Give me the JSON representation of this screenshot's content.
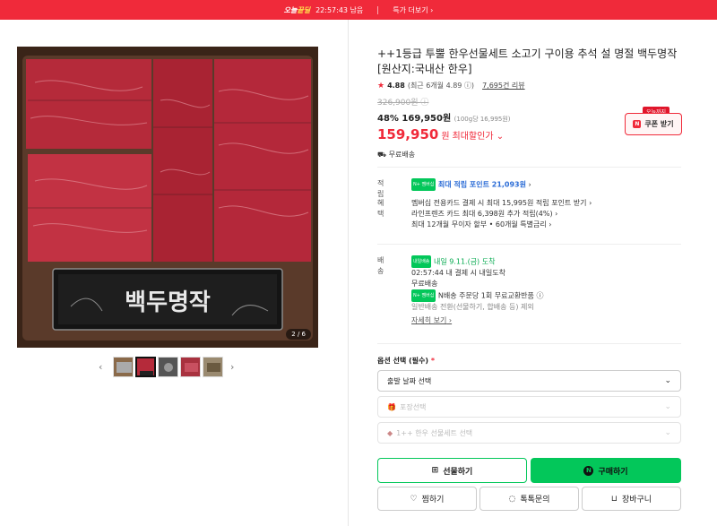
{
  "topbar": {
    "brand_a": "오늘",
    "brand_b": "끝딜",
    "timer": "22:57:43 남음",
    "more": "특가 더보기"
  },
  "gallery": {
    "counter": "2 / 6"
  },
  "product": {
    "title": "++1등급 투뿔 한우선물세트 소고기 구이용 추석 설 명절 백두명작 [원산지:국내산 한우]",
    "rating": "4.88",
    "rating_detail": "(최근 6개월 4.89",
    "reviews": "7,695건 리뷰",
    "original_price": "326,900원",
    "discount": "48%",
    "sale_price": "169,950원",
    "unit_price": "(100g당 16,995원)",
    "final_price": "159,950",
    "final_won": "원",
    "max_discount": "최대할인가",
    "shipping": "무료배송"
  },
  "coupon": {
    "tag": "오늘까지",
    "label": "쿠폰 받기",
    "nbadge": "N"
  },
  "benefit": {
    "point_label": "적립",
    "point_text": "최대 적립 포인트 21,093원",
    "benefit_label": "혜택",
    "line1": "멤버십 전용카드 결제 시 최대 15,995원 적립 포인트 받기",
    "line2": "라인프렌즈 카드 최대 6,398원 추가 적립(4%)",
    "line3": "최대 12개월 무이자 할부 • 60개월 특별금리"
  },
  "delivery": {
    "label": "배송",
    "badge": "내일배송",
    "arrive": "내일 9.11.(금) 도착",
    "cutoff": "02:57:44  내 결제 시 내일도착",
    "free": "무료배송",
    "return": "N배송 주문당 1회 무료교환반품",
    "note": "일반배송 전환(선물하기, 합배송 등) 제외",
    "more": "자세히 보기"
  },
  "options": {
    "label": "옵션 선택 (필수)",
    "req": "*",
    "opt1": "출발 날짜 선택",
    "opt2": "포장선택",
    "opt3": "1++ 한우 선물세트 선택"
  },
  "buttons": {
    "gift": "선물하기",
    "buy": "구매하기",
    "wish": "찜하기",
    "talk": "톡톡문의",
    "cart": "장바구니"
  },
  "npay_badge": "N+ 멤버십"
}
